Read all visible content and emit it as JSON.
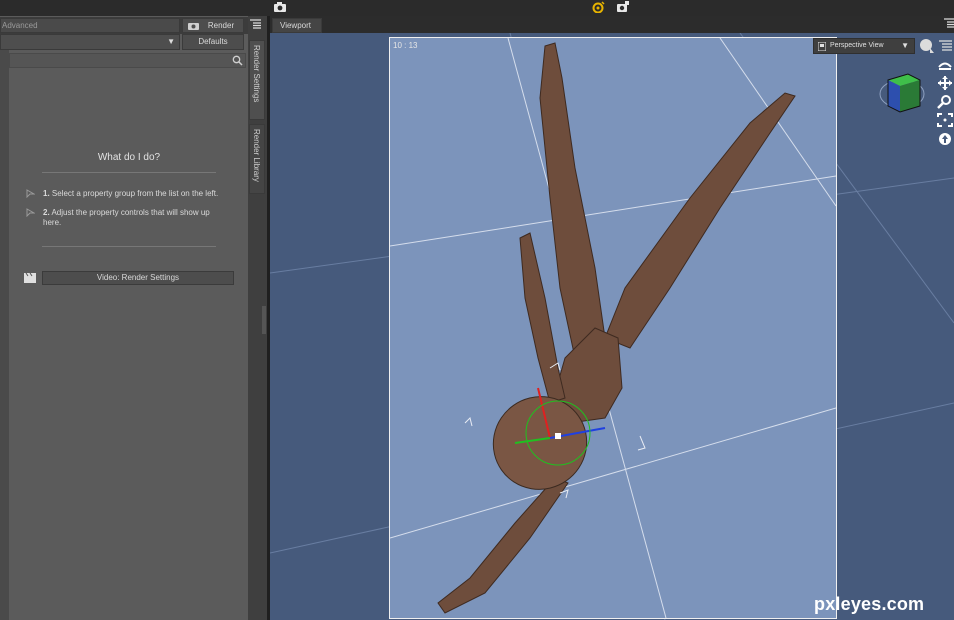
{
  "toolbar": {
    "render_label": "Render",
    "defaults_label": "Defaults",
    "advanced_tab": "Advanced"
  },
  "side_tabs": [
    "Render Settings",
    "Render Library"
  ],
  "help": {
    "title": "What do I do?",
    "step1_num": "1.",
    "step1_text": " Select a property group from the list on the left.",
    "step2_num": "2.",
    "step2_text": " Adjust the property controls that will show up here.",
    "video_button": "Video: Render Settings"
  },
  "viewport": {
    "tab_label": "Viewport",
    "frame_ratio": "10 : 13",
    "camera_select": "Perspective View",
    "bg_color": "#465a7c",
    "frame_color": "#7c94bb"
  },
  "watermark": "pxleyes.com",
  "colors": {
    "panel": "#5b5b5b",
    "dark": "#2b2b2b",
    "accent_icon": "#e8b400"
  }
}
